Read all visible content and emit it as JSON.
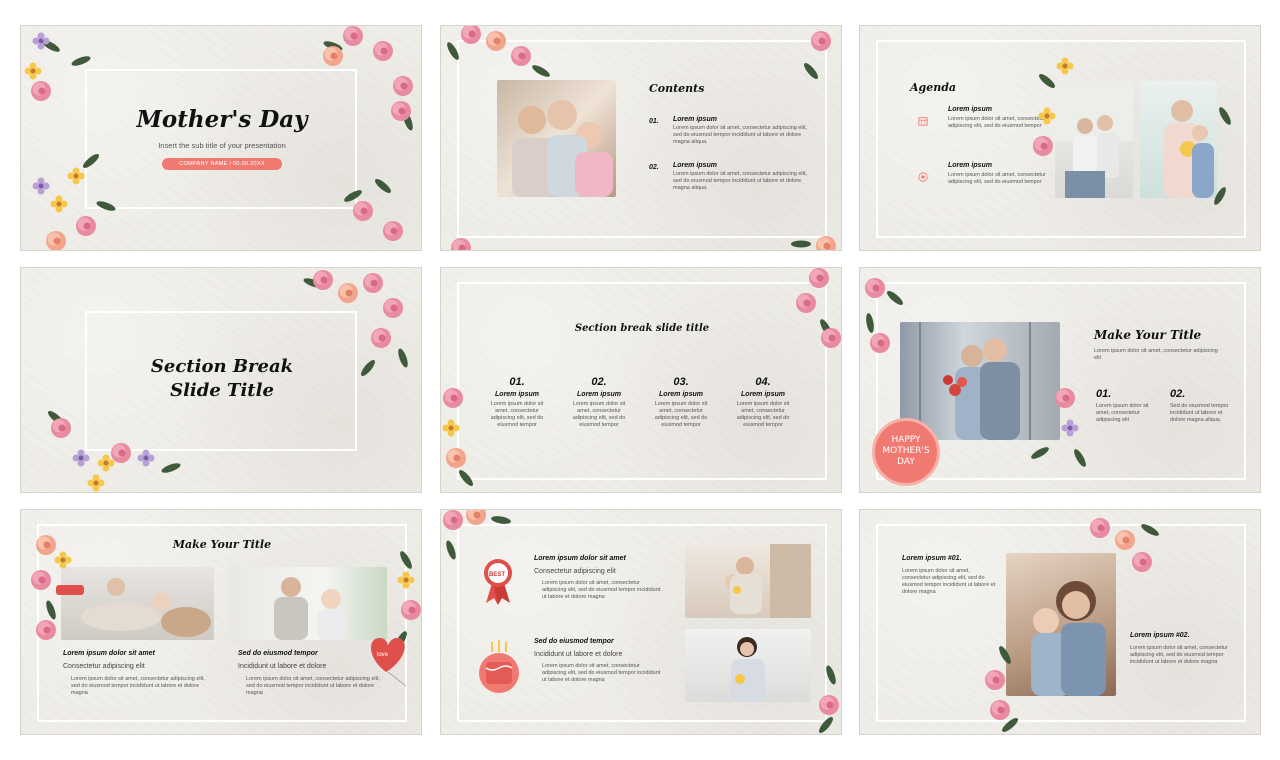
{
  "slides": {
    "s1": {
      "title": "Mother's Day",
      "subtitle": "Insert the sub title of your presentation",
      "company": "COMPANY NAME  /  00.00.20XX"
    },
    "s2": {
      "heading": "Contents",
      "items": [
        {
          "num": "01.",
          "title": "Lorem ipsum",
          "text": "Lorem ipsum dolor sit amet, consectetur adipiscing elit, sed do eiusmod tempor incididunt ut labore et dolore magna aliqua."
        },
        {
          "num": "02.",
          "title": "Lorem ipsum",
          "text": "Lorem ipsum dolor sit amet, consectetur adipiscing elit, sed do eiusmod tempor incididunt ut labore et dolore magna aliqua."
        }
      ]
    },
    "s3": {
      "heading": "Agenda",
      "items": [
        {
          "title": "Lorem ipsum",
          "text": "Lorem ipsum dolor sit amet, consectetur adipiscing elit, sed do eiusmod tempor"
        },
        {
          "title": "Lorem ipsum",
          "text": "Lorem ipsum dolor sit amet, consectetur adipiscing elit, sed do eiusmod tempor"
        }
      ]
    },
    "s4": {
      "title_line1": "Section Break",
      "title_line2": "Slide Title"
    },
    "s5": {
      "heading": "Section break slide title",
      "cols": [
        {
          "num": "01.",
          "title": "Lorem ipsum",
          "text": "Lorem ipsum dolor sit amet, consectetur adipiscing elit, sed do eiusmod tempor"
        },
        {
          "num": "02.",
          "title": "Lorem ipsum",
          "text": "Lorem ipsum dolor sit amet, consectetur adipiscing elit, sed do eiusmod tempor"
        },
        {
          "num": "03.",
          "title": "Lorem ipsum",
          "text": "Lorem ipsum dolor sit amet, consectetur adipiscing elit, sed do eiusmod tempor"
        },
        {
          "num": "04.",
          "title": "Lorem ipsum",
          "text": "Lorem ipsum dolor sit amet, consectetur adipiscing elit, sed do eiusmod tempor"
        }
      ]
    },
    "s6": {
      "heading": "Make Your Title",
      "intro": "Lorem ipsum dolor sit amet, consectetur adipiscing elit",
      "items": [
        {
          "num": "01.",
          "text": "Lorem ipsum dolor sit amet, consectetur adipiscing elit"
        },
        {
          "num": "02.",
          "text": "Sed do eiusmod tempor incididunt ut labore et dolore magna aliqua."
        }
      ],
      "badge_line1": "HAPPY",
      "badge_line2": "MOTHER'S",
      "badge_line3": "DAY"
    },
    "s7": {
      "heading": "Make Your Title",
      "cards": [
        {
          "title": "Lorem ipsum dolor sit amet",
          "sub": "Consectetur adipiscing elit",
          "text": "Lorem ipsum dolor sit amet, consectetur adipiscing elit, sed do eiusmod tempor incididunt ut labore et dolore magna"
        },
        {
          "title": "Sed do eiusmod tempor",
          "sub": "Incididunt ut labore et dolore",
          "text": "Lorem ipsum dolor sit amet, consectetur adipiscing elit, sed do eiusmod tempor incididunt ut labore et dolore magna"
        }
      ]
    },
    "s8": {
      "blocks": [
        {
          "title": "Lorem ipsum dolor sit amet",
          "sub": "Consectetur adipiscing elit",
          "text": "Lorem ipsum dolor sit amet, consectetur adipiscing elit, sed do eiusmod tempor incididunt ut labore et dolore magna"
        },
        {
          "title": "Sed do eiusmod tempor",
          "sub": "Incididunt ut labore et dolore",
          "text": "Lorem ipsum dolor sit amet, consectetur adipiscing elit, sed do eiusmod tempor incididunt ut labore et dolore magna"
        }
      ]
    },
    "s9": {
      "blocks": [
        {
          "title": "Lorem ipsum #01.",
          "text": "Lorem ipsum dolor sit amet, consectetur adipiscing elit, sed do eiusmod tempor incididunt ut labore et dolore magna"
        },
        {
          "title": "Lorem ipsum #02.",
          "text": "Lorem ipsum dolor sit amet, consectetur adipiscing elit, sed do eiusmod tempor incididunt ut labore et dolore magna"
        }
      ]
    }
  },
  "colors": {
    "accent": "#f07a72",
    "bg": "#efede8",
    "frame": "#ffffff"
  }
}
